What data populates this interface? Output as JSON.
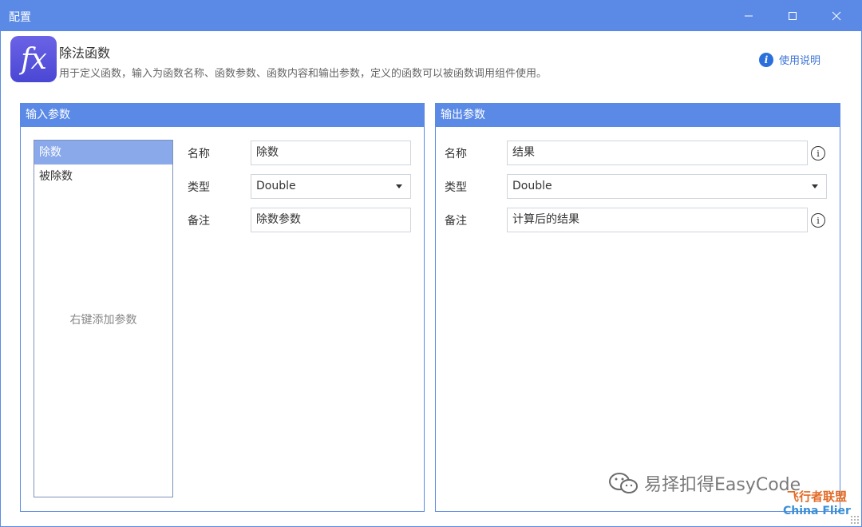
{
  "window": {
    "title": "配置"
  },
  "header": {
    "logo_text": "fx",
    "function_name": "除法函数",
    "description": "用于定义函数，输入为函数名称、函数参数、函数内容和输出参数，定义的函数可以被函数调用组件使用。",
    "help_label": "使用说明",
    "help_icon_glyph": "i"
  },
  "input_panel": {
    "title": "输入参数",
    "params": [
      {
        "label": "除数",
        "selected": true
      },
      {
        "label": "被除数",
        "selected": false
      }
    ],
    "list_hint": "右键添加参数",
    "form": {
      "name_label": "名称",
      "name_value": "除数",
      "type_label": "类型",
      "type_value": "Double",
      "note_label": "备注",
      "note_value": "除数参数"
    }
  },
  "output_panel": {
    "title": "输出参数",
    "form": {
      "name_label": "名称",
      "name_value": "结果",
      "type_label": "类型",
      "type_value": "Double",
      "note_label": "备注",
      "note_value": "计算后的结果"
    },
    "info_glyph": "i"
  },
  "watermark": {
    "text": "易择扣得EasyCode",
    "brand_cn": "飞行者联盟",
    "brand_en": "China Flier"
  },
  "colors": {
    "accent": "#5b8ae6",
    "selected_row": "#8aa9ea",
    "link": "#3b73d8"
  }
}
